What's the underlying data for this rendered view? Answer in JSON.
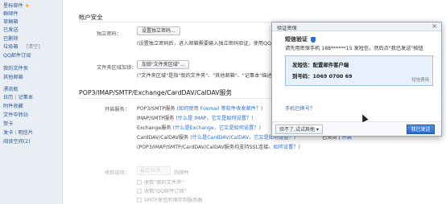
{
  "sidebar": {
    "items": [
      {
        "label": "星标邮件",
        "icon": "star-icon"
      },
      {
        "label": "群邮件"
      },
      {
        "label": "草稿箱"
      },
      {
        "label": "已发送"
      },
      {
        "label": "已删除"
      },
      {
        "label": "垃圾箱",
        "tag": "[清空]"
      },
      {
        "label": "QQ邮件订阅"
      },
      {
        "label": "我的文件夹"
      },
      {
        "label": "其他邮箱"
      },
      {
        "label": "漂流瓶"
      },
      {
        "label": "日历",
        "sep": "|",
        "label2": "记事本"
      },
      {
        "label": "附件收藏"
      },
      {
        "label": "文件中转站"
      },
      {
        "label": "贺卡"
      },
      {
        "label": "发卡",
        "sep": "|",
        "label2": "明信片"
      },
      {
        "label": "阅读空间(2)"
      }
    ]
  },
  "account": {
    "title": "帐户安全",
    "independent_password_label": "独立密码：",
    "independent_password_button": "设置独立密码...",
    "independent_password_desc": "(设置独立密码后，进入邮箱需要输入独立密码验证，使用QQ邮箱需",
    "folder_label": "文件夹区域加锁：",
    "folder_button": "加锁\"文件夹区域\"...",
    "folder_desc": "(\"文件夹区域\"是指\"我的文件夹\"、\"其他邮箱\"、\"记事本\"描述，加"
  },
  "pop": {
    "title": "POP3/IMAP/SMTP/Exchange/CardDAV/CalDAV服务",
    "open_label": "开启服务：",
    "rows": [
      {
        "text": "POP3/SMTP服务",
        "link": "(如何使用 Foxmail 等软件收发邮件？)"
      },
      {
        "text": "IMAP/SMTP服务",
        "link": "(什么是 IMAP，它又是如何设置？)"
      },
      {
        "text": "Exchange服务",
        "link": "(什么是Exchange，它又是如何设置？)"
      },
      {
        "text": "CardDAV/CalDAV服务",
        "link": "(什么是CardDAV/CalDAV，它又是如何设置？)"
      },
      {
        "text": "(POP3/IMAP/SMTP/CardDAV/CalDAV服务均支持SSL连接。",
        "link": "如何设置？)"
      }
    ],
    "aside_prefix": "已关闭",
    "aside_link": "开启",
    "receive_label": "收取选项：",
    "receive_select": "最近30天",
    "receive_suffix": "的邮件",
    "checkboxes": [
      "收取\"我的文件夹\"",
      "收取\"QQ邮件订阅\"",
      "SMTP发信后保存到服务器"
    ]
  },
  "dialog": {
    "title": "验证密保",
    "close": "×",
    "heading": "短信验证",
    "desc": "请先用密保手机 188******15 发短信，然后点\"我已发送\"按钮",
    "sms_line1": "发短信：配置邮件客户端",
    "sms_line2": "到号码：1069 0700 69",
    "copy": "短信费用",
    "changed": "手机已换号？",
    "other_button": "验不了,试试其他 ▾",
    "primary_button": "我已发送"
  },
  "colors": {
    "link": "#2b6fd6",
    "primary": "#2a69cf",
    "sms_bg": "#e6f1fb"
  }
}
